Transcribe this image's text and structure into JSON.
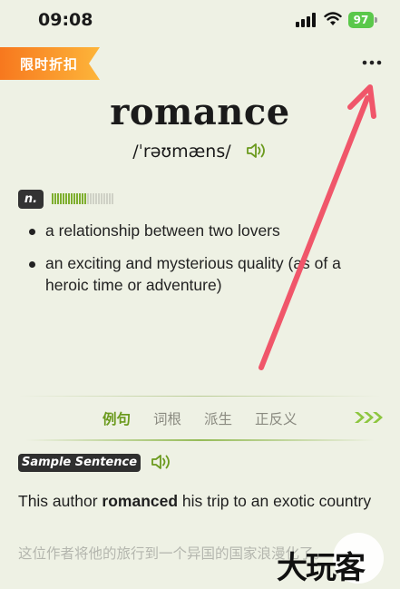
{
  "status_bar": {
    "time": "09:08",
    "battery": "97"
  },
  "promo": {
    "label": "限时折扣"
  },
  "entry": {
    "word": "romance",
    "phonetic": "/ˈrəʊmæns/",
    "part_of_speech": "n.",
    "frequency_level": 0.55,
    "definitions": [
      "a relationship between two lovers",
      "an exciting and mysterious quality (as of a heroic time or adventure)"
    ]
  },
  "tabs": {
    "items": [
      "例句",
      "词根",
      "派生",
      "正反义"
    ],
    "active": "例句"
  },
  "sample": {
    "badge": "Sample Sentence",
    "sentence_before": "This author ",
    "sentence_highlight": "romanced",
    "sentence_after": " his trip to an exotic country",
    "translation": "这位作者将他的旅行到一个异国的国家浪漫化了。"
  },
  "watermark": {
    "text": "大玩客"
  },
  "colors": {
    "accent_green": "#6b9a1e",
    "promo_orange": "#f7931e",
    "annotation_red": "#f0566a"
  }
}
